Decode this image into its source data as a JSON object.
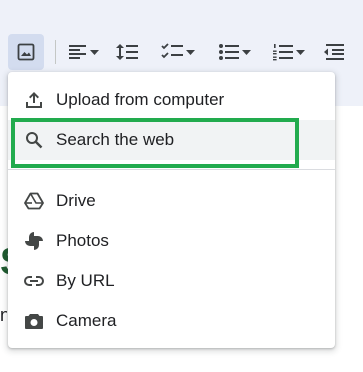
{
  "toolbar": {
    "buttons": [
      {
        "name": "insert-image",
        "icon": "image-icon"
      },
      {
        "name": "align",
        "icon": "align-left-icon"
      },
      {
        "name": "line-spacing",
        "icon": "line-spacing-icon"
      },
      {
        "name": "checklist",
        "icon": "checklist-icon"
      },
      {
        "name": "bulleted-list",
        "icon": "bulleted-list-icon"
      },
      {
        "name": "numbered-list",
        "icon": "numbered-list-icon"
      },
      {
        "name": "decrease-indent",
        "icon": "decrease-indent-icon"
      }
    ]
  },
  "menu": {
    "items": [
      {
        "label": "Upload from computer",
        "icon": "upload-icon"
      },
      {
        "label": "Search the web",
        "icon": "search-icon"
      },
      {
        "label": "Drive",
        "icon": "drive-icon"
      },
      {
        "label": "Photos",
        "icon": "photos-icon"
      },
      {
        "label": "By URL",
        "icon": "link-icon"
      },
      {
        "label": "Camera",
        "icon": "camera-icon"
      }
    ]
  },
  "document": {
    "fragment_heading": "S",
    "fragment_text": "n"
  },
  "colors": {
    "toolbar_bg": "#eef1f9",
    "active_button_bg": "#d3dcef",
    "highlight_border": "#22ab4e",
    "hover_bg": "#f1f3f4",
    "heading_color": "#1e5b2f"
  }
}
